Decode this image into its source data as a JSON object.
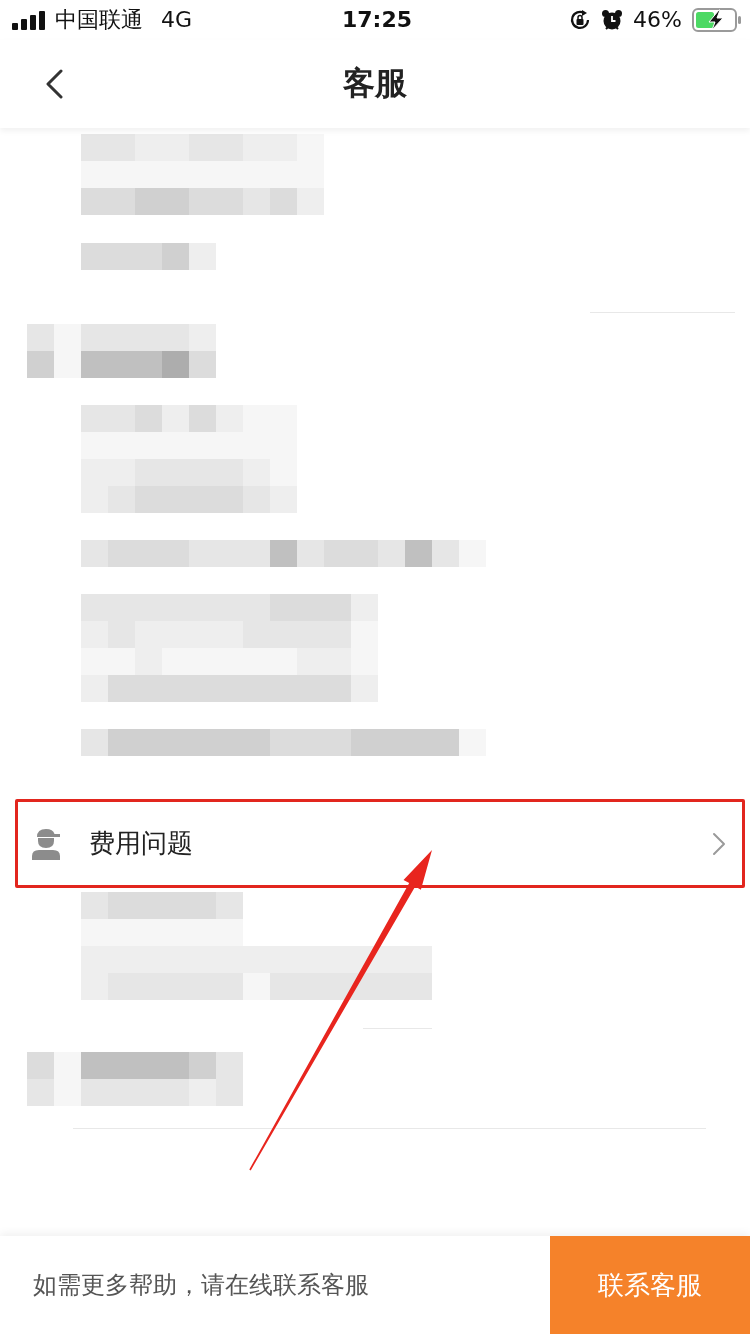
{
  "status_bar": {
    "carrier": "中国联通",
    "network": "4G",
    "time": "17:25",
    "battery": "46%"
  },
  "nav_bar": {
    "title": "客服"
  },
  "help_item": {
    "label": "费用问题"
  },
  "footer": {
    "hint": "如需更多帮助，请在线联系客服",
    "button": "联系客服"
  }
}
